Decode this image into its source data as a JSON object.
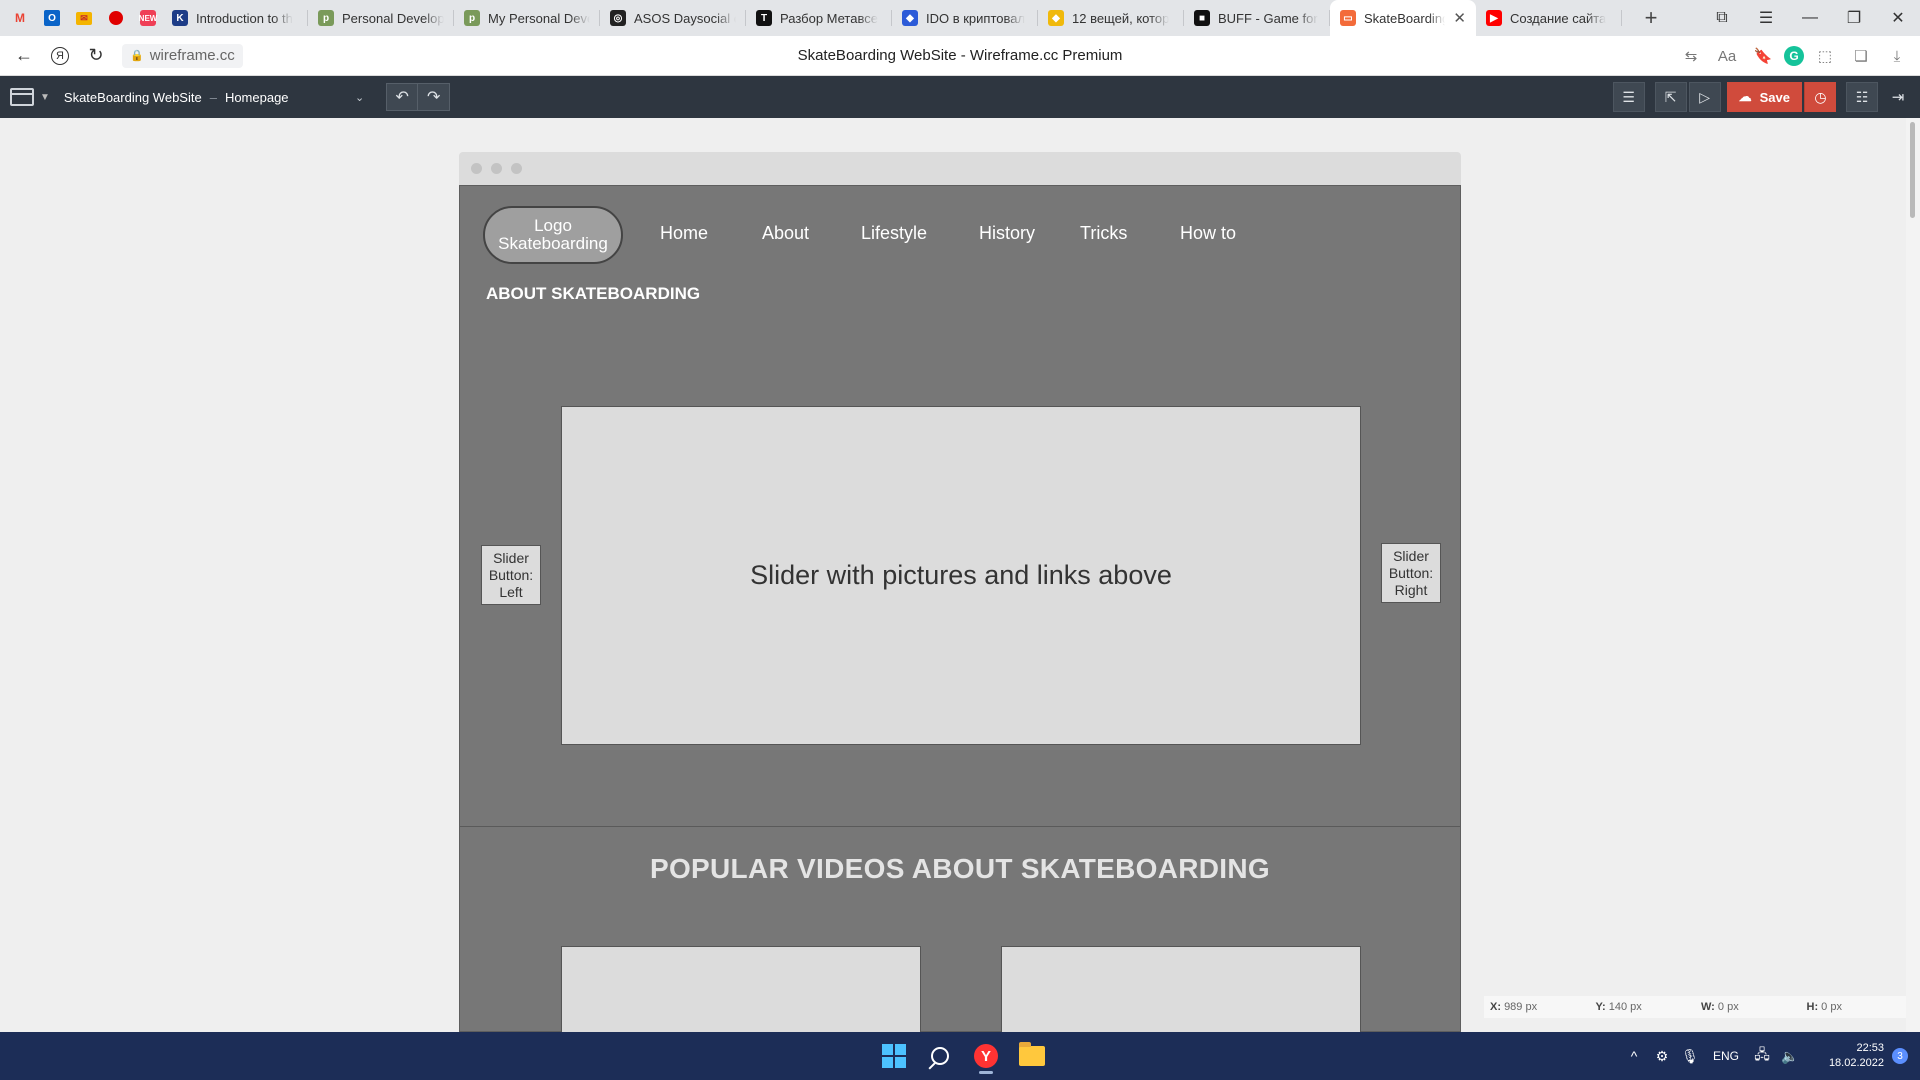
{
  "browser": {
    "tabs": [
      {
        "title": "Introduction to th",
        "icon": "K",
        "color": "#1d3c87"
      },
      {
        "title": "Personal Develop",
        "icon": "p",
        "color": "#7a9a5a"
      },
      {
        "title": "My Personal Deve",
        "icon": "p",
        "color": "#7a9a5a"
      },
      {
        "title": "ASOS Daysocial c",
        "icon": "◎",
        "color": "#222222"
      },
      {
        "title": "Разбор Метавсе",
        "icon": "T",
        "color": "#111111"
      },
      {
        "title": "IDO в криптовал",
        "icon": "◆",
        "color": "#2c5bd8"
      },
      {
        "title": "12 вещей, котор",
        "icon": "◆",
        "color": "#f0b90b"
      },
      {
        "title": "BUFF - Game for",
        "icon": "■",
        "color": "#111111"
      },
      {
        "title": "SkateBoarding",
        "icon": "▭",
        "color": "#f36b3a"
      },
      {
        "title": "Создание сайта",
        "icon": "▶",
        "color": "#ff0000"
      }
    ],
    "url": "wireframe.cc",
    "page_title": "SkateBoarding WebSite - Wireframe.cc Premium"
  },
  "app": {
    "project_name": "SkateBoarding WebSite",
    "separator": "–",
    "page_name": "Homepage",
    "save_label": "Save"
  },
  "wireframe": {
    "logo_line1": "Logo",
    "logo_line2": "Skateboarding",
    "nav": [
      "Home",
      "About",
      "Lifestyle",
      "History",
      "Tricks",
      "How to"
    ],
    "about_heading": "ABOUT SKATEBOARDING",
    "slider_text": "Slider with pictures and links above",
    "slider_left": [
      "Slider",
      "Button:",
      "Left"
    ],
    "slider_right": [
      "Slider",
      "Button:",
      "Right"
    ],
    "videos_heading": "POPULAR VIDEOS ABOUT SKATEBOARDING"
  },
  "coords": {
    "x_label": "X:",
    "x": "989 px",
    "y_label": "Y:",
    "y": "140 px",
    "w_label": "W:",
    "w": "0 px",
    "h_label": "H:",
    "h": "0 px"
  },
  "taskbar": {
    "lang": "ENG",
    "time": "22:53",
    "date": "18.02.2022",
    "notifications": "3"
  }
}
